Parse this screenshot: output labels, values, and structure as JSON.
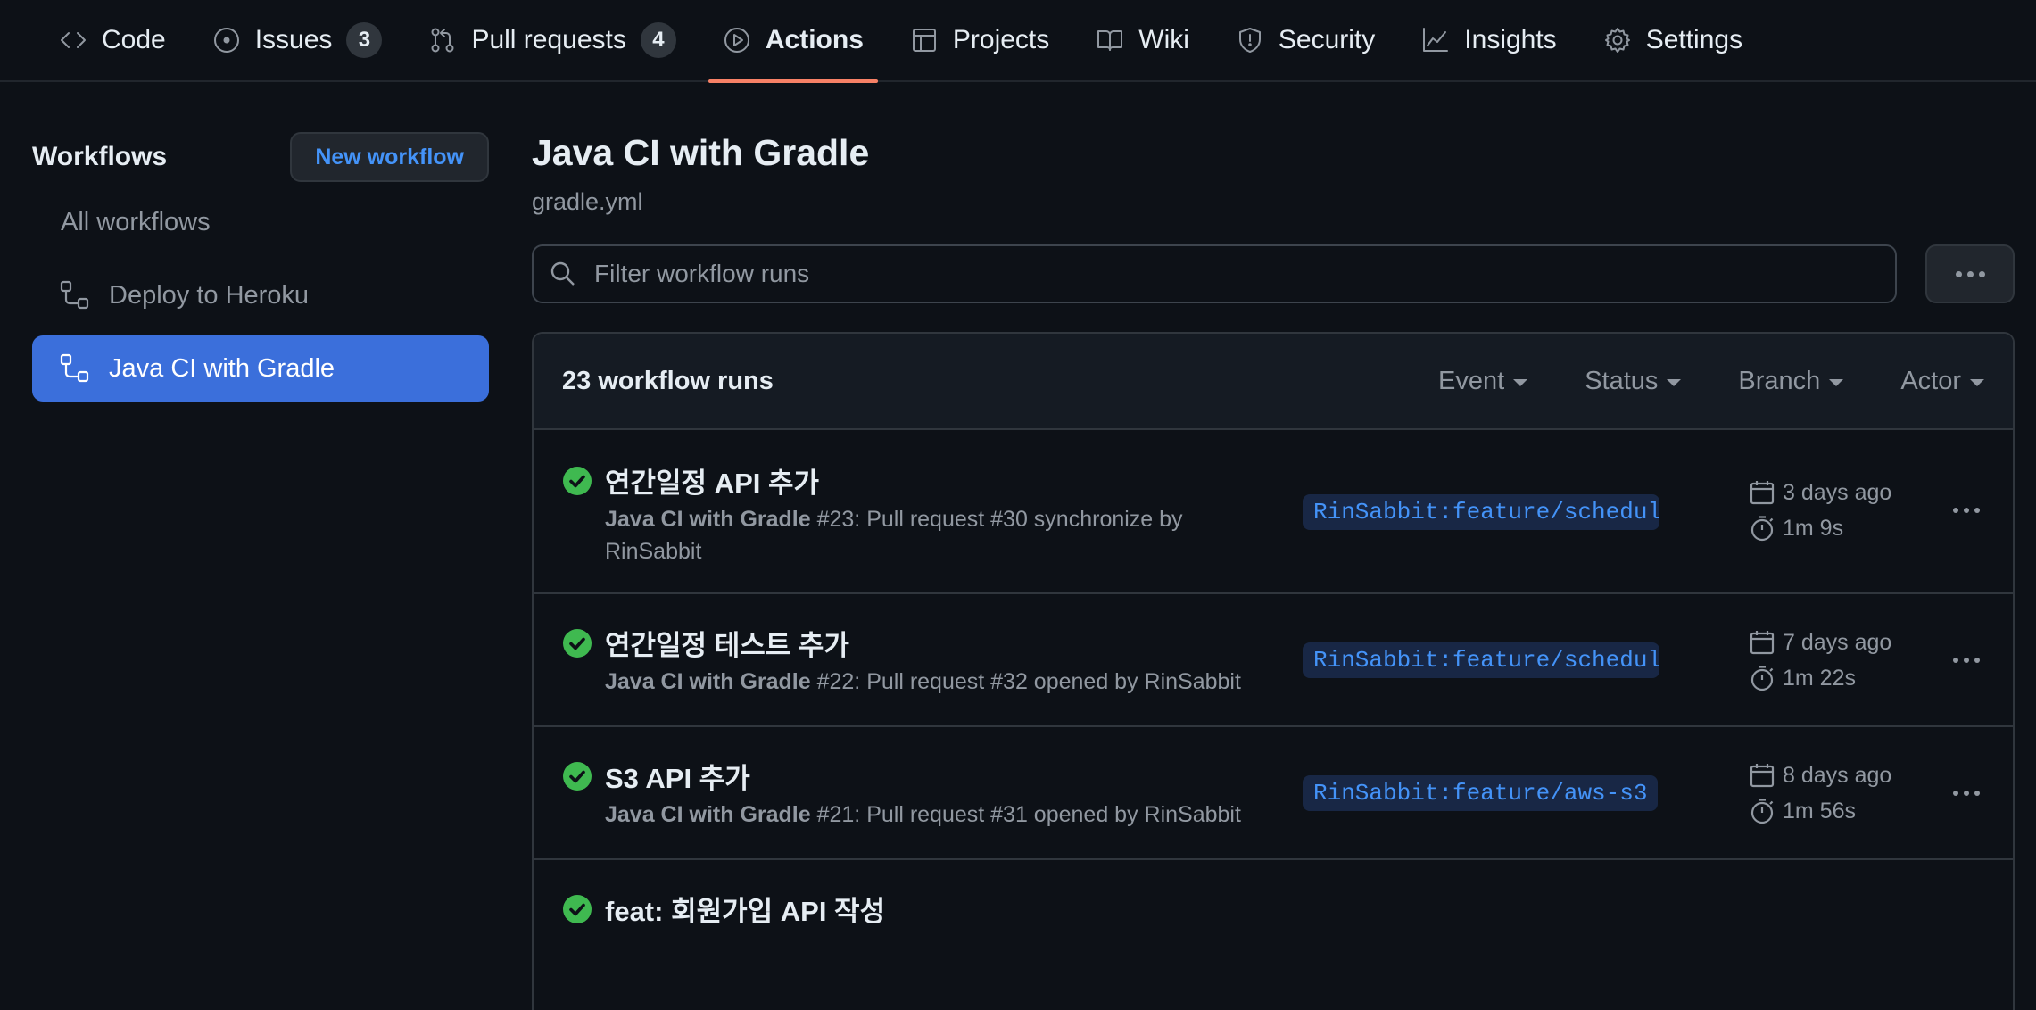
{
  "nav": {
    "tabs": [
      {
        "label": "Code",
        "icon": "code-icon"
      },
      {
        "label": "Issues",
        "icon": "issue-opened-icon",
        "count": "3"
      },
      {
        "label": "Pull requests",
        "icon": "git-pull-request-icon",
        "count": "4"
      },
      {
        "label": "Actions",
        "icon": "play-icon",
        "active": true
      },
      {
        "label": "Projects",
        "icon": "table-icon"
      },
      {
        "label": "Wiki",
        "icon": "book-icon"
      },
      {
        "label": "Security",
        "icon": "shield-icon"
      },
      {
        "label": "Insights",
        "icon": "graph-icon"
      },
      {
        "label": "Settings",
        "icon": "gear-icon"
      }
    ]
  },
  "sidebar": {
    "title": "Workflows",
    "new_workflow_label": "New workflow",
    "items": [
      {
        "label": "All workflows"
      },
      {
        "label": "Deploy to Heroku",
        "icon": "workflow-icon"
      },
      {
        "label": "Java CI with Gradle",
        "icon": "workflow-icon",
        "active": true
      }
    ]
  },
  "main": {
    "title": "Java CI with Gradle",
    "subtitle": "gradle.yml",
    "filter_placeholder": "Filter workflow runs",
    "runs_count": "23 workflow runs",
    "filters": [
      "Event",
      "Status",
      "Branch",
      "Actor"
    ],
    "runs": [
      {
        "title": "연간일정 API 추가",
        "workflow": "Java CI with Gradle",
        "detail": " #23: Pull request #30 synchronize by RinSabbit",
        "branch": "RinSabbit:feature/schedule",
        "date": "3 days ago",
        "duration": "1m 9s",
        "status": "success"
      },
      {
        "title": "연간일정 테스트 추가",
        "workflow": "Java CI with Gradle",
        "detail": " #22: Pull request #32 opened by RinSabbit",
        "branch": "RinSabbit:feature/schedul…",
        "date": "7 days ago",
        "duration": "1m 22s",
        "status": "success"
      },
      {
        "title": "S3 API 추가",
        "workflow": "Java CI with Gradle",
        "detail": " #21: Pull request #31 opened by RinSabbit",
        "branch": "RinSabbit:feature/aws-s3",
        "date": "8 days ago",
        "duration": "1m 56s",
        "status": "success"
      },
      {
        "title": "feat: 회원가입 API 작성",
        "status": "success"
      }
    ]
  },
  "colors": {
    "background": "#0d1117",
    "accent_underline": "#f78166",
    "active_item": "#3b6fdb",
    "success": "#3fb950",
    "link": "#4493f8"
  }
}
